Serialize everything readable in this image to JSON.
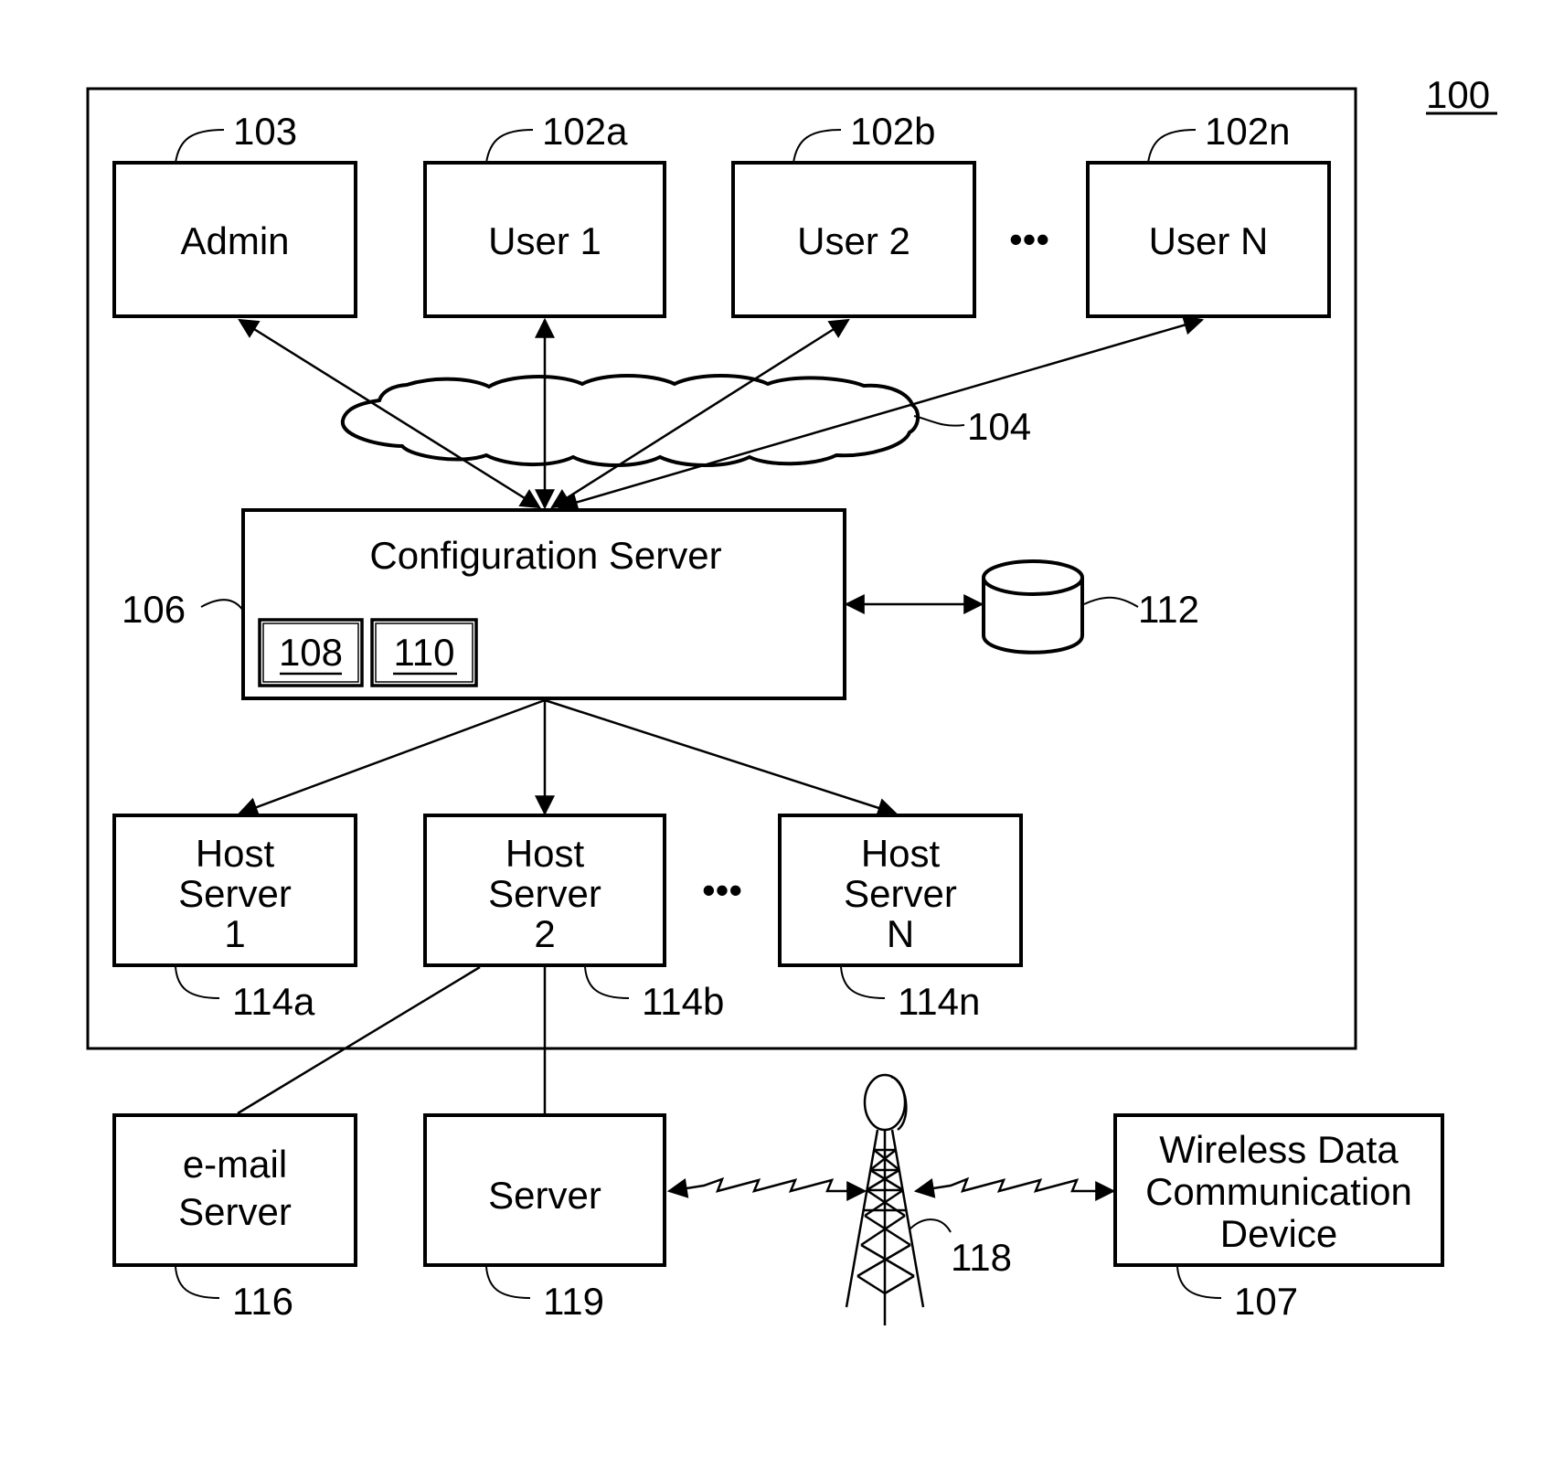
{
  "figure": {
    "figure_number": "100",
    "system_boundary": "system-100"
  },
  "nodes": {
    "admin": {
      "label": "Admin",
      "ref": "103"
    },
    "user1": {
      "label": "User 1",
      "ref": "102a"
    },
    "user2": {
      "label": "User 2",
      "ref": "102b"
    },
    "userN": {
      "label": "User N",
      "ref": "102n"
    },
    "network": {
      "ref": "104"
    },
    "config_server": {
      "label": "Configuration Server",
      "ref": "106",
      "sub1": "108",
      "sub2": "110"
    },
    "database": {
      "ref": "112"
    },
    "host1": {
      "line1": "Host",
      "line2": "Server",
      "line3": "1",
      "ref": "114a"
    },
    "host2": {
      "line1": "Host",
      "line2": "Server",
      "line3": "2",
      "ref": "114b"
    },
    "hostN": {
      "line1": "Host",
      "line2": "Server",
      "line3": "N",
      "ref": "114n"
    },
    "email_server": {
      "line1": "e-mail",
      "line2": "Server",
      "ref": "116"
    },
    "server": {
      "label": "Server",
      "ref": "119"
    },
    "tower": {
      "ref": "118"
    },
    "wireless_device": {
      "line1": "Wireless Data",
      "line2": "Communication",
      "line3": "Device",
      "ref": "107"
    }
  },
  "ellipsis": "•••"
}
